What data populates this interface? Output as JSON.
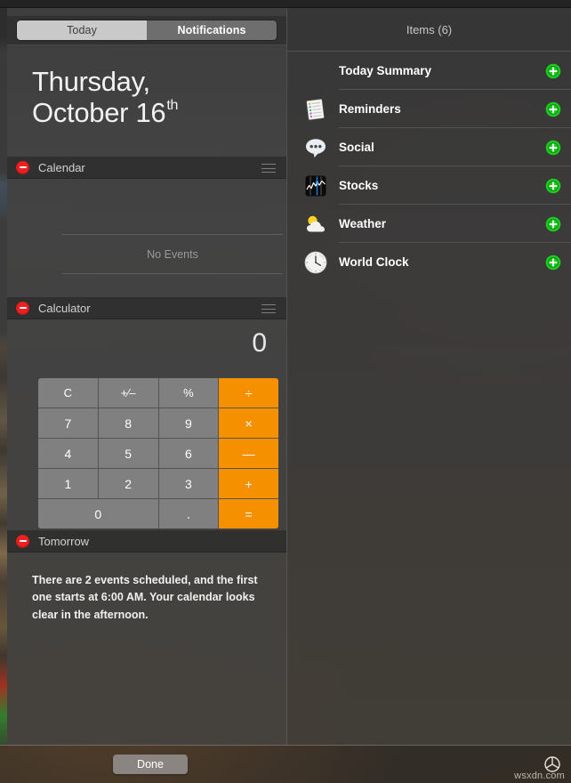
{
  "window": {
    "tabs": [
      {
        "label": "Today",
        "selected": true
      },
      {
        "label": "Notifications",
        "selected": false
      }
    ]
  },
  "today": {
    "date_weekday": "Thursday,",
    "date_month_day": "October 16",
    "date_ordinal": "th",
    "widgets": [
      {
        "id": "calendar",
        "title": "Calendar",
        "remove_icon": "minus-circle-icon",
        "drag_icon": "drag-handle-icon",
        "empty_text": "No Events"
      },
      {
        "id": "calculator",
        "title": "Calculator",
        "remove_icon": "minus-circle-icon",
        "drag_icon": "drag-handle-icon",
        "display_value": "0",
        "keys": [
          {
            "label": "C",
            "type": "function"
          },
          {
            "label": "+⁄–",
            "type": "function"
          },
          {
            "label": "%",
            "type": "function"
          },
          {
            "label": "÷",
            "type": "operator"
          },
          {
            "label": "7",
            "type": "digit"
          },
          {
            "label": "8",
            "type": "digit"
          },
          {
            "label": "9",
            "type": "digit"
          },
          {
            "label": "×",
            "type": "operator"
          },
          {
            "label": "4",
            "type": "digit"
          },
          {
            "label": "5",
            "type": "digit"
          },
          {
            "label": "6",
            "type": "digit"
          },
          {
            "label": "—",
            "type": "operator"
          },
          {
            "label": "1",
            "type": "digit"
          },
          {
            "label": "2",
            "type": "digit"
          },
          {
            "label": "3",
            "type": "digit"
          },
          {
            "label": "+",
            "type": "operator"
          },
          {
            "label": "0",
            "type": "digit-wide"
          },
          {
            "label": ".",
            "type": "dot"
          },
          {
            "label": "=",
            "type": "operator"
          }
        ]
      },
      {
        "id": "tomorrow",
        "title": "Tomorrow",
        "remove_icon": "minus-circle-icon",
        "body_text": "There are 2 events scheduled, and the first one starts at 6:00 AM. Your calendar looks clear in the afternoon."
      }
    ]
  },
  "items_panel": {
    "header": "Items (6)",
    "items": [
      {
        "label": "Today Summary",
        "icon": "none",
        "add_icon": "plus-circle-icon"
      },
      {
        "label": "Reminders",
        "icon": "reminders-icon",
        "add_icon": "plus-circle-icon"
      },
      {
        "label": "Social",
        "icon": "social-icon",
        "add_icon": "plus-circle-icon"
      },
      {
        "label": "Stocks",
        "icon": "stocks-icon",
        "add_icon": "plus-circle-icon"
      },
      {
        "label": "Weather",
        "icon": "weather-icon",
        "add_icon": "plus-circle-icon"
      },
      {
        "label": "World Clock",
        "icon": "world-clock-icon",
        "add_icon": "plus-circle-icon"
      }
    ]
  },
  "bottom_bar": {
    "done_label": "Done",
    "settings_icon": "gear-icon",
    "watermark": "wsxdn.com"
  },
  "colors": {
    "accent_orange": "#f59100",
    "add_green": "#19cc1e",
    "remove_red": "#f02020",
    "panel_dark": "#3e3e3e",
    "key_gray": "#808080"
  }
}
